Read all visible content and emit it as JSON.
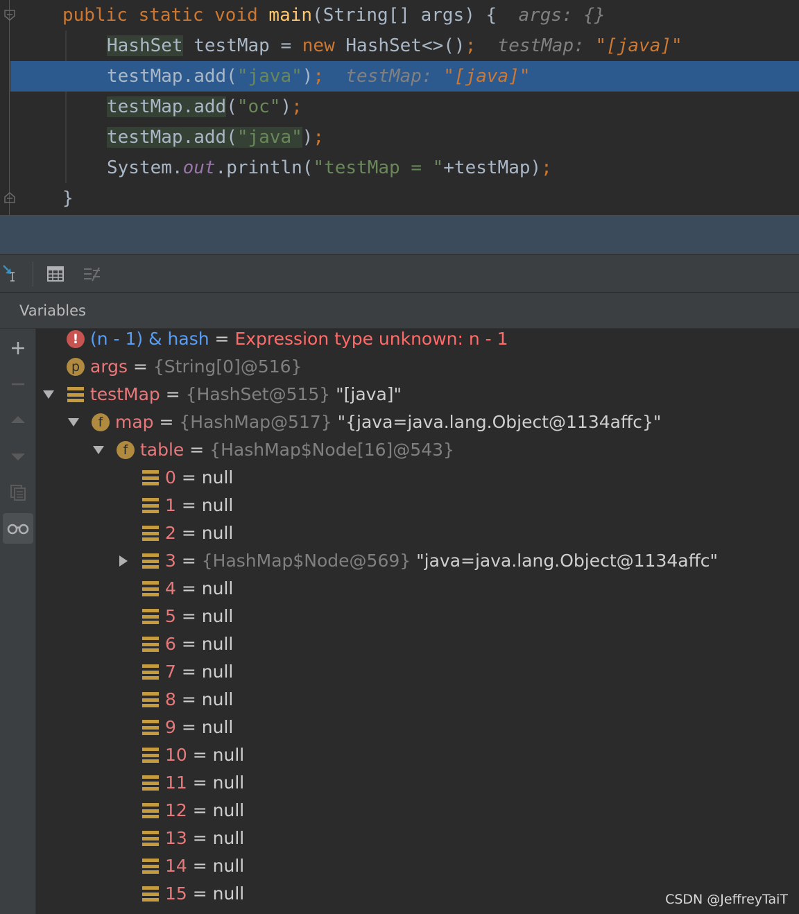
{
  "editor": {
    "lines": [
      {
        "parts": [
          [
            "kw",
            "public static void "
          ],
          [
            "fn",
            "main"
          ],
          [
            "",
            "(String[] args) {  "
          ],
          [
            "hint",
            "args: {}"
          ]
        ]
      },
      {
        "parts": [
          [
            "hl",
            "HashSet"
          ],
          [
            "",
            " testMap = "
          ],
          [
            "kw",
            "new "
          ],
          [
            "",
            "HashSet<>()"
          ],
          [
            "kw",
            ";"
          ],
          [
            "",
            " "
          ],
          [
            "hint",
            " testMap: "
          ],
          [
            "hintv",
            "\"[java]\""
          ]
        ]
      },
      {
        "parts": [
          [
            "",
            "testMap.add("
          ],
          [
            "str",
            "\"java\""
          ],
          [
            "",
            ")"
          ],
          [
            "kw",
            ";"
          ],
          [
            "",
            "  "
          ],
          [
            "hint",
            "testMap: "
          ],
          [
            "hintv",
            "\"[java]\""
          ]
        ]
      },
      {
        "parts": [
          [
            "hl",
            "testMap.add"
          ],
          [
            "",
            "("
          ],
          [
            "str",
            "\"oc\""
          ],
          [
            "",
            ")"
          ],
          [
            "kw",
            ";"
          ]
        ]
      },
      {
        "parts": [
          [
            "hl",
            "testMap.add"
          ],
          [
            "hl",
            "("
          ],
          [
            "hlstr",
            "\"java\""
          ],
          [
            "",
            ")"
          ],
          [
            "kw",
            ";"
          ]
        ]
      },
      {
        "parts": [
          [
            "",
            "System."
          ],
          [
            "static",
            "out"
          ],
          [
            "",
            ".println("
          ],
          [
            "str",
            "\"testMap = \""
          ],
          [
            "",
            "+testMap)"
          ],
          [
            "kw",
            ";"
          ]
        ]
      },
      {
        "parts": [
          [
            "",
            "}"
          ]
        ]
      }
    ]
  },
  "panel": {
    "title": "Variables"
  },
  "icons": {
    "toolbar": [
      "show-execution-point-icon",
      "table-view-icon",
      "mute-breakpoints-icon"
    ],
    "side": [
      "add-watch-icon",
      "remove-watch-icon",
      "move-up-icon",
      "move-down-icon",
      "duplicate-icon",
      "watches-glasses-icon"
    ]
  },
  "variables": [
    {
      "level": 0,
      "icon": "err",
      "arrow": "",
      "name": "(n - 1) & hash",
      "name_kind": "expr",
      "eq": " = ",
      "ref": "",
      "value": "Expression type unknown: n - 1",
      "value_kind": "err"
    },
    {
      "level": 0,
      "icon": "p",
      "arrow": "",
      "name": "args",
      "eq": " = ",
      "ref": "{String[0]@516}",
      "value": ""
    },
    {
      "level": 0,
      "icon": "list",
      "arrow": "down",
      "name": "testMap",
      "eq": " = ",
      "ref": "{HashSet@515}",
      "value": " \"[java]\""
    },
    {
      "level": 1,
      "icon": "f",
      "arrow": "down",
      "name": "map",
      "eq": " = ",
      "ref": "{HashMap@517}",
      "value": " \"{java=java.lang.Object@1134affc}\""
    },
    {
      "level": 2,
      "icon": "f",
      "arrow": "down",
      "name": "table",
      "eq": " = ",
      "ref": "{HashMap$Node[16]@543}",
      "value": ""
    },
    {
      "level": 3,
      "icon": "list",
      "arrow": "",
      "name": "0",
      "eq": " = ",
      "ref": "",
      "value": "null"
    },
    {
      "level": 3,
      "icon": "list",
      "arrow": "",
      "name": "1",
      "eq": " = ",
      "ref": "",
      "value": "null"
    },
    {
      "level": 3,
      "icon": "list",
      "arrow": "",
      "name": "2",
      "eq": " = ",
      "ref": "",
      "value": "null"
    },
    {
      "level": 3,
      "icon": "list",
      "arrow": "right",
      "name": "3",
      "eq": " = ",
      "ref": "{HashMap$Node@569}",
      "value": " \"java=java.lang.Object@1134affc\""
    },
    {
      "level": 3,
      "icon": "list",
      "arrow": "",
      "name": "4",
      "eq": " = ",
      "ref": "",
      "value": "null"
    },
    {
      "level": 3,
      "icon": "list",
      "arrow": "",
      "name": "5",
      "eq": " = ",
      "ref": "",
      "value": "null"
    },
    {
      "level": 3,
      "icon": "list",
      "arrow": "",
      "name": "6",
      "eq": " = ",
      "ref": "",
      "value": "null"
    },
    {
      "level": 3,
      "icon": "list",
      "arrow": "",
      "name": "7",
      "eq": " = ",
      "ref": "",
      "value": "null"
    },
    {
      "level": 3,
      "icon": "list",
      "arrow": "",
      "name": "8",
      "eq": " = ",
      "ref": "",
      "value": "null"
    },
    {
      "level": 3,
      "icon": "list",
      "arrow": "",
      "name": "9",
      "eq": " = ",
      "ref": "",
      "value": "null"
    },
    {
      "level": 3,
      "icon": "list",
      "arrow": "",
      "name": "10",
      "eq": " = ",
      "ref": "",
      "value": "null"
    },
    {
      "level": 3,
      "icon": "list",
      "arrow": "",
      "name": "11",
      "eq": " = ",
      "ref": "",
      "value": "null"
    },
    {
      "level": 3,
      "icon": "list",
      "arrow": "",
      "name": "12",
      "eq": " = ",
      "ref": "",
      "value": "null"
    },
    {
      "level": 3,
      "icon": "list",
      "arrow": "",
      "name": "13",
      "eq": " = ",
      "ref": "",
      "value": "null"
    },
    {
      "level": 3,
      "icon": "list",
      "arrow": "",
      "name": "14",
      "eq": " = ",
      "ref": "",
      "value": "null"
    },
    {
      "level": 3,
      "icon": "list",
      "arrow": "",
      "name": "15",
      "eq": " = ",
      "ref": "",
      "value": "null"
    }
  ],
  "watermark": "CSDN @JeffreyTaiT",
  "colors": {
    "background": "#2b2b2b",
    "current_line": "#2d5a8e",
    "keyword": "#cc7832",
    "string": "#6a8759",
    "var_name": "#e8787a",
    "error": "#ff6b68"
  }
}
